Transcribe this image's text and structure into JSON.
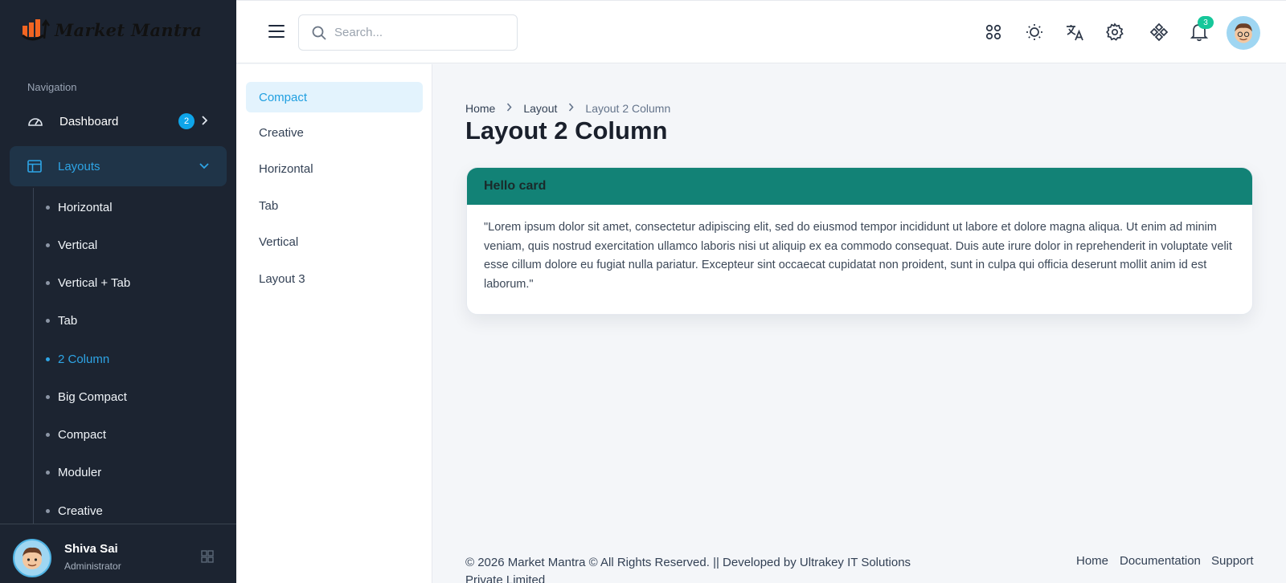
{
  "brand": {
    "name": "Market Mantra"
  },
  "sidebar": {
    "caption": "Navigation",
    "dashboard": {
      "label": "Dashboard",
      "badge": "2"
    },
    "layouts": {
      "label": "Layouts"
    },
    "layout_items": [
      "Horizontal",
      "Vertical",
      "Vertical + Tab",
      "Tab",
      "2 Column",
      "Big Compact",
      "Compact",
      "Moduler",
      "Creative"
    ],
    "active_item": "2 Column",
    "user": {
      "name": "Shiva Sai",
      "role": "Administrator"
    }
  },
  "header": {
    "search_placeholder": "Search...",
    "notification_count": "3",
    "icons": [
      "apps-icon",
      "sun-icon",
      "translate-icon",
      "gear-icon",
      "diamond-grid-icon",
      "bell-icon"
    ]
  },
  "subcolumn": {
    "items": [
      "Compact",
      "Creative",
      "Horizontal",
      "Tab",
      "Vertical",
      "Layout 3"
    ],
    "active": "Compact"
  },
  "breadcrumb": {
    "home": "Home",
    "section": "Layout",
    "current": "Layout 2 Column"
  },
  "page_title": "Layout 2 Column",
  "card": {
    "title": "Hello card",
    "body": "\"Lorem ipsum dolor sit amet, consectetur adipiscing elit, sed do eiusmod tempor incididunt ut labore et dolore magna aliqua. Ut enim ad minim veniam, quis nostrud exercitation ullamco laboris nisi ut aliquip ex ea commodo consequat. Duis aute irure dolor in reprehenderit in voluptate velit esse cillum dolore eu fugiat nulla pariatur. Excepteur sint occaecat cupidatat non proident, sunt in culpa qui officia deserunt mollit anim id est laborum.\""
  },
  "footer": {
    "copyright": "© 2026 Market Mantra © All Rights Reserved. || Developed by Ultrakey IT Solutions Private Limited",
    "links": [
      "Home",
      "Documentation",
      "Support"
    ]
  },
  "colors": {
    "sidebar_bg": "#1c2431",
    "accent": "#2ea5e6",
    "card_header": "#128276",
    "badge": "#16c79a"
  }
}
